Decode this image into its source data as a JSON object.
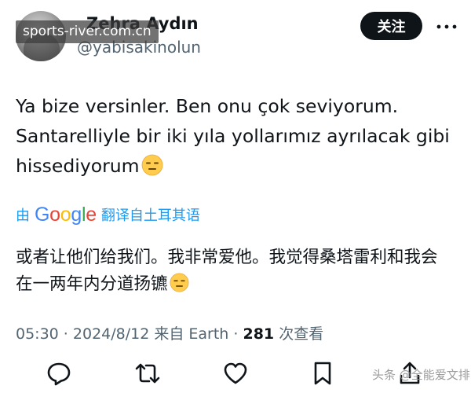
{
  "user": {
    "display_name": "Zehra Aydın",
    "handle": "@yabisakinolun"
  },
  "watermarks": {
    "top": "sports-river.com.cn",
    "bottom": "头条 @全能爱文排"
  },
  "header": {
    "follow_label": "关注",
    "more_icon": "more-horizontal-icon"
  },
  "tweet": {
    "lines": [
      "Ya bize versinler. Ben onu çok seviyorum.",
      "Santarelliyle bir iki yıla yollarımız ayrılacak gibi",
      "hissediyorum"
    ],
    "emoji": "expressionless-face-emoji"
  },
  "translation": {
    "by_label": "由",
    "google_letters": [
      "G",
      "o",
      "o",
      "g",
      "l",
      "e"
    ],
    "google_colors": [
      "#4285F4",
      "#EA4335",
      "#FBBC05",
      "#4285F4",
      "#34A853",
      "#EA4335"
    ],
    "action_label": "翻译自土耳其语",
    "lines": [
      "或者让他们给我们。我非常爱他。我觉得桑塔雷利和我会",
      "在一两年内分道扬镳"
    ]
  },
  "meta": {
    "time": "05:30",
    "separator": " · ",
    "date": "2024/8/12",
    "source": "来自 Earth",
    "views_count": "281",
    "views_label": "次查看"
  },
  "actions": [
    {
      "name": "reply-icon"
    },
    {
      "name": "retweet-icon"
    },
    {
      "name": "like-icon"
    },
    {
      "name": "bookmark-icon"
    },
    {
      "name": "share-icon"
    }
  ],
  "colors": {
    "text": "#0f1419",
    "secondary": "#536471",
    "accent": "#1d9bf0",
    "button_bg": "#0f1419",
    "button_text": "#ffffff"
  }
}
